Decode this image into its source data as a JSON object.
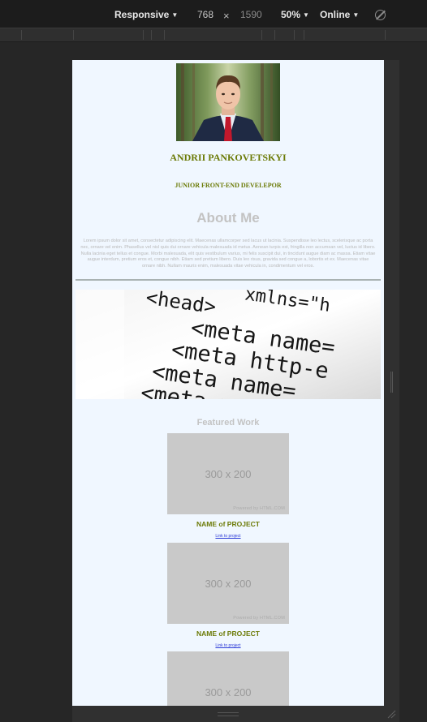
{
  "devtools": {
    "device": "Responsive",
    "width": "768",
    "times": "×",
    "height": "1590",
    "zoom": "50%",
    "throttle": "Online"
  },
  "profile": {
    "name": "ANDRII PANKOVETSKYI",
    "role": "JUNIOR FRONT-END DEVELEPOR"
  },
  "about": {
    "title": "About Me",
    "text": "Lorem ipsum dolor sit amet, consectetur adipiscing elit. Maecenas ullamcorper sed lacus ut lacinia. Suspendisse leo lectus, scelerisque ac porta nec, ornare vel enim. Phasellus vel nisl quis dui ornare vehicula malesuada id metus. Aenean turpis est, fringilla non accumsan vel, luctus id libero. Nulla lacinia eget tellus et congue. Morbi malesuada, elit quis vestibulum varius, mi felis suscipit dui, in tincidunt augue diam ac massa. Etiam vitae augue interdum, pretium eros et, congue nibh. Etiam sed pretium libero. Duis leo risus, gravida sed congue a, lobortis et ex. Maecenas vitae ornare nibh. Nullam mauris enim, malesuada vitae vehicula in, condimentum vel eros."
  },
  "code_image": {
    "lines": [
      "<head>",
      "<meta name=",
      "<meta http-e",
      "<meta name=",
      "xmlns=\"h"
    ]
  },
  "featured": {
    "title": "Featured Work",
    "projects": [
      {
        "thumb": "300 x 200",
        "powered": "Powered by HTML.COM",
        "name": "NAME of PROJECT",
        "link": "Link to project"
      },
      {
        "thumb": "300 x 200",
        "powered": "Powered by HTML.COM",
        "name": "NAME of PROJECT",
        "link": "Link to project"
      },
      {
        "thumb": "300 x 200",
        "powered": "",
        "name": "",
        "link": ""
      }
    ]
  }
}
